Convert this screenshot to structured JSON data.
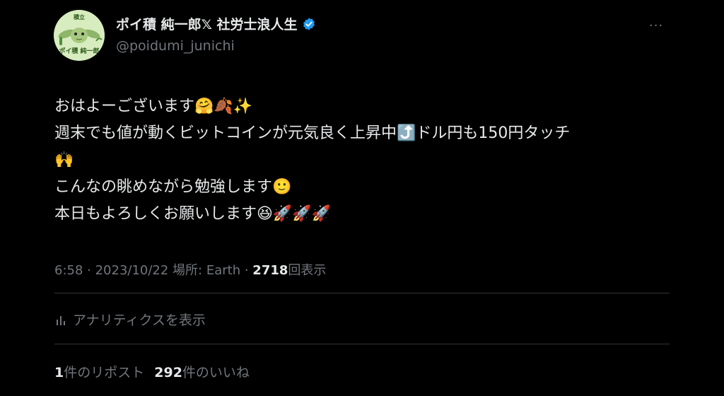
{
  "author": {
    "display_name": "ポイ積 純一郎𝕏 社労士浪人生",
    "handle": "@poidumi_junichi",
    "avatar_top_text": "積立",
    "avatar_bottom_text": "ポイ積 純一郎",
    "verified_color": "#1d9bf0"
  },
  "tweet": {
    "lines": [
      "おはよーございます🤗🍂✨",
      "週末でも値が動くビットコインが元気良く上昇中⤴️ドル円も150円タッチ",
      "🙌",
      "こんなの眺めながら勉強します🙂",
      "本日もよろしくお願いします😆🚀🚀🚀"
    ]
  },
  "meta": {
    "time_date_place": "6:58 · 2023/10/22 場所: Earth ·",
    "views_count": "2718",
    "views_label": "回表示"
  },
  "analytics": {
    "label": "アナリティクスを表示",
    "icon": "analytics-bar-icon"
  },
  "stats": {
    "reposts_count": "1",
    "reposts_label": "件のリポスト",
    "likes_count": "292",
    "likes_label": "件のいいね"
  },
  "more_label": "···",
  "colors": {
    "background": "#000000",
    "text_primary": "#e7e9ea",
    "text_secondary": "#71767b",
    "divider": "#2f3336",
    "verified": "#1d9bf0"
  }
}
